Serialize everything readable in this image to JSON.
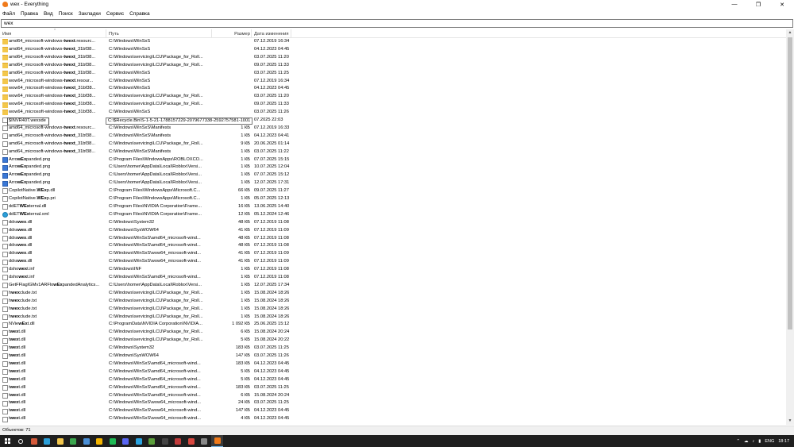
{
  "window": {
    "title": "wex - Everything",
    "controls": [
      "minimize",
      "maximize",
      "close"
    ]
  },
  "menu": [
    "Файл",
    "Правка",
    "Вид",
    "Поиск",
    "Закладки",
    "Сервис",
    "Справка"
  ],
  "search": {
    "value": "wex"
  },
  "columns": {
    "name": "Имя",
    "path": "Путь",
    "size": "Размер",
    "date": "Дата изменения"
  },
  "rename_box": {
    "value": "$INVR40T.wexsde"
  },
  "tooltip": {
    "text": "C:\\$Recycle.Bin\\S-1-5-21-1788157229-2079677338-2592757581-1001"
  },
  "rows": [
    {
      "name_pre": "amd64_microsoft-windows-",
      "name_match": "twext",
      "name_post": ".resourc...",
      "path": "C:\\Windows\\WinSxS",
      "size": "",
      "date": "07.12.2019 16:34",
      "icon": "folder"
    },
    {
      "name_pre": "amd64_microsoft-windows-",
      "name_match": "twext",
      "name_post": "_31bf38...",
      "path": "C:\\Windows\\WinSxS",
      "size": "",
      "date": "04.12.2023 04:45",
      "icon": "folder"
    },
    {
      "name_pre": "amd64_microsoft-windows-",
      "name_match": "twext",
      "name_post": "_31bf38...",
      "path": "C:\\Windows\\servicing\\LCU\\Package_for_Roll...",
      "size": "",
      "date": "03.07.2025 11:20",
      "icon": "folder"
    },
    {
      "name_pre": "amd64_microsoft-windows-",
      "name_match": "twext",
      "name_post": "_31bf38...",
      "path": "C:\\Windows\\servicing\\LCU\\Package_for_Roll...",
      "size": "",
      "date": "09.07.2025 11:33",
      "icon": "folder"
    },
    {
      "name_pre": "amd64_microsoft-windows-",
      "name_match": "twext",
      "name_post": "_31bf38...",
      "path": "C:\\Windows\\WinSxS",
      "size": "",
      "date": "03.07.2025 11:25",
      "icon": "folder"
    },
    {
      "name_pre": "wow64_microsoft-windows-",
      "name_match": "twext",
      "name_post": ".resour...",
      "path": "C:\\Windows\\WinSxS",
      "size": "",
      "date": "07.12.2019 16:34",
      "icon": "folder"
    },
    {
      "name_pre": "wow64_microsoft-windows-",
      "name_match": "twext",
      "name_post": "_31bf38...",
      "path": "C:\\Windows\\WinSxS",
      "size": "",
      "date": "04.12.2023 04:45",
      "icon": "folder"
    },
    {
      "name_pre": "wow64_microsoft-windows-",
      "name_match": "twext",
      "name_post": "_31bf38...",
      "path": "C:\\Windows\\servicing\\LCU\\Package_for_Roll...",
      "size": "",
      "date": "03.07.2025 11:20",
      "icon": "folder"
    },
    {
      "name_pre": "wow64_microsoft-windows-",
      "name_match": "twext",
      "name_post": "_31bf38...",
      "path": "C:\\Windows\\servicing\\LCU\\Package_for_Roll...",
      "size": "",
      "date": "09.07.2025 11:33",
      "icon": "folder"
    },
    {
      "name_pre": "wow64_microsoft-windows-",
      "name_match": "twext",
      "name_post": "_31bf38...",
      "path": "C:\\Windows\\WinSxS",
      "size": "",
      "date": "03.07.2025 11:26",
      "icon": "folder"
    },
    {
      "name_pre": "",
      "name_match": "",
      "name_post": "",
      "path": "",
      "size": "",
      "date": "07.2025 22:03",
      "icon": "file"
    },
    {
      "name_pre": "amd64_microsoft-windows-",
      "name_match": "twext",
      "name_post": ".resourc...",
      "path": "C:\\Windows\\WinSxS\\Manifests",
      "size": "1 КБ",
      "date": "07.12.2019 16:33",
      "icon": "file"
    },
    {
      "name_pre": "amd64_microsoft-windows-",
      "name_match": "twext",
      "name_post": "_31bf38...",
      "path": "C:\\Windows\\WinSxS\\Manifests",
      "size": "1 КБ",
      "date": "04.12.2023 04:41",
      "icon": "file"
    },
    {
      "name_pre": "amd64_microsoft-windows-",
      "name_match": "twext",
      "name_post": "_31bf38...",
      "path": "C:\\Windows\\servicing\\LCU\\Package_for_Roll...",
      "size": "9 КБ",
      "date": "20.06.2025 01:14",
      "icon": "file"
    },
    {
      "name_pre": "amd64_microsoft-windows-",
      "name_match": "twext",
      "name_post": "_31bf38...",
      "path": "C:\\Windows\\WinSxS\\Manifests",
      "size": "1 КБ",
      "date": "03.07.2025 11:22",
      "icon": "file"
    },
    {
      "name_pre": "Arro",
      "name_match": "wEx",
      "name_post": "panded.png",
      "path": "C:\\Program Files\\WindowsApps\\ROBLOXCO...",
      "size": "1 КБ",
      "date": "07.07.2025 15:15",
      "icon": "png"
    },
    {
      "name_pre": "Arro",
      "name_match": "wEx",
      "name_post": "panded.png",
      "path": "C:\\Users\\homer\\AppData\\Local\\Roblox\\Versi...",
      "size": "1 КБ",
      "date": "10.07.2025 12:04",
      "icon": "png"
    },
    {
      "name_pre": "Arro",
      "name_match": "wEx",
      "name_post": "panded.png",
      "path": "C:\\Users\\homer\\AppData\\Local\\Roblox\\Versi...",
      "size": "1 КБ",
      "date": "07.07.2025 15:12",
      "icon": "png"
    },
    {
      "name_pre": "Arro",
      "name_match": "wEx",
      "name_post": "panded.png",
      "path": "C:\\Users\\homer\\AppData\\Local\\Roblox\\Versi...",
      "size": "1 КБ",
      "date": "12.07.2025 17:31",
      "icon": "png"
    },
    {
      "name_pre": "CopilotNative.",
      "name_match": "WEx",
      "name_post": "p.dll",
      "path": "C:\\Program Files\\WindowsApps\\Microsoft.C...",
      "size": "66 КБ",
      "date": "09.07.2025 11:27",
      "icon": "file"
    },
    {
      "name_pre": "CopilotNative.",
      "name_match": "WEx",
      "name_post": "p.pri",
      "path": "C:\\Program Files\\WindowsApps\\Microsoft.C...",
      "size": "1 КБ",
      "date": "05.07.2025 12:13",
      "icon": "file"
    },
    {
      "name_pre": "ddET",
      "name_match": "WEx",
      "name_post": "ternal.dll",
      "path": "C:\\Program Files\\NVIDIA Corporation\\Frame...",
      "size": "16 КБ",
      "date": "13.06.2025 14:40",
      "icon": "file"
    },
    {
      "name_pre": "ddET",
      "name_match": "WEx",
      "name_post": "ternal.xml",
      "path": "C:\\Program Files\\NVIDIA Corporation\\Frame...",
      "size": "12 КБ",
      "date": "05.12.2024 12:46",
      "icon": "edge"
    },
    {
      "name_pre": "ddra",
      "name_match": "wex",
      "name_post": ".dll",
      "path": "C:\\Windows\\System32",
      "size": "48 КБ",
      "date": "07.12.2019 11:08",
      "icon": "file"
    },
    {
      "name_pre": "ddra",
      "name_match": "wex",
      "name_post": ".dll",
      "path": "C:\\Windows\\SysWOW64",
      "size": "41 КБ",
      "date": "07.12.2019 11:09",
      "icon": "file"
    },
    {
      "name_pre": "ddra",
      "name_match": "wex",
      "name_post": ".dll",
      "path": "C:\\Windows\\WinSxS\\amd64_microsoft-wind...",
      "size": "48 КБ",
      "date": "07.12.2019 11:08",
      "icon": "file"
    },
    {
      "name_pre": "ddra",
      "name_match": "wex",
      "name_post": ".dll",
      "path": "C:\\Windows\\WinSxS\\amd64_microsoft-wind...",
      "size": "48 КБ",
      "date": "07.12.2019 11:08",
      "icon": "file"
    },
    {
      "name_pre": "ddra",
      "name_match": "wex",
      "name_post": ".dll",
      "path": "C:\\Windows\\WinSxS\\wow64_microsoft-wind...",
      "size": "41 КБ",
      "date": "07.12.2019 11:09",
      "icon": "file"
    },
    {
      "name_pre": "ddra",
      "name_match": "wex",
      "name_post": ".dll",
      "path": "C:\\Windows\\WinSxS\\wow64_microsoft-wind...",
      "size": "41 КБ",
      "date": "07.12.2019 11:09",
      "icon": "file"
    },
    {
      "name_pre": "dsho",
      "name_match": "wex",
      "name_post": "t.inf",
      "path": "C:\\Windows\\INF",
      "size": "1 КБ",
      "date": "07.12.2019 11:08",
      "icon": "file"
    },
    {
      "name_pre": "dsho",
      "name_match": "wex",
      "name_post": "t.inf",
      "path": "C:\\Windows\\WinSxS\\amd64_microsoft-wind...",
      "size": "1 КБ",
      "date": "07.12.2019 11:08",
      "icon": "file"
    },
    {
      "name_pre": "GetFFlagIGMv1ARFlo",
      "name_match": "wEx",
      "name_post": "pandedAnalytics...",
      "path": "C:\\Users\\homer\\AppData\\Local\\Roblox\\Versi...",
      "size": "1 КБ",
      "date": "12.07.2025 17:34",
      "icon": "file"
    },
    {
      "name_pre": "h",
      "name_match": "wex",
      "name_post": "clude.txt",
      "path": "C:\\Windows\\servicing\\LCU\\Package_for_Roll...",
      "size": "1 КБ",
      "date": "15.08.2024 18:26",
      "icon": "text"
    },
    {
      "name_pre": "h",
      "name_match": "wex",
      "name_post": "clude.txt",
      "path": "C:\\Windows\\servicing\\LCU\\Package_for_Roll...",
      "size": "1 КБ",
      "date": "15.08.2024 18:26",
      "icon": "text"
    },
    {
      "name_pre": "h",
      "name_match": "wex",
      "name_post": "clude.txt",
      "path": "C:\\Windows\\servicing\\LCU\\Package_for_Roll...",
      "size": "1 КБ",
      "date": "15.08.2024 18:26",
      "icon": "text"
    },
    {
      "name_pre": "h",
      "name_match": "wex",
      "name_post": "clude.txt",
      "path": "C:\\Windows\\servicing\\LCU\\Package_for_Roll...",
      "size": "1 КБ",
      "date": "15.08.2024 18:26",
      "icon": "text"
    },
    {
      "name_pre": "NVie",
      "name_match": "wEx",
      "name_post": "t.dll",
      "path": "C:\\ProgramData\\NVIDIA Corporation\\NVIDIA...",
      "size": "1 092 КБ",
      "date": "25.06.2025 15:12",
      "icon": "file"
    },
    {
      "name_pre": "t",
      "name_match": "wex",
      "name_post": "t.dll",
      "path": "C:\\Windows\\servicing\\LCU\\Package_for_Roll...",
      "size": "6 КБ",
      "date": "15.08.2024 20:24",
      "icon": "file"
    },
    {
      "name_pre": "t",
      "name_match": "wex",
      "name_post": "t.dll",
      "path": "C:\\Windows\\servicing\\LCU\\Package_for_Roll...",
      "size": "5 КБ",
      "date": "15.08.2024 20:22",
      "icon": "file"
    },
    {
      "name_pre": "t",
      "name_match": "wex",
      "name_post": "t.dll",
      "path": "C:\\Windows\\System32",
      "size": "183 КБ",
      "date": "03.07.2025 11:25",
      "icon": "file"
    },
    {
      "name_pre": "t",
      "name_match": "wex",
      "name_post": "t.dll",
      "path": "C:\\Windows\\SysWOW64",
      "size": "147 КБ",
      "date": "03.07.2025 11:26",
      "icon": "file"
    },
    {
      "name_pre": "t",
      "name_match": "wex",
      "name_post": "t.dll",
      "path": "C:\\Windows\\WinSxS\\amd64_microsoft-wind...",
      "size": "183 КБ",
      "date": "04.12.2023 04:45",
      "icon": "file"
    },
    {
      "name_pre": "t",
      "name_match": "wex",
      "name_post": "t.dll",
      "path": "C:\\Windows\\WinSxS\\amd64_microsoft-wind...",
      "size": "5 КБ",
      "date": "04.12.2023 04:45",
      "icon": "file"
    },
    {
      "name_pre": "t",
      "name_match": "wex",
      "name_post": "t.dll",
      "path": "C:\\Windows\\WinSxS\\amd64_microsoft-wind...",
      "size": "5 КБ",
      "date": "04.12.2023 04:45",
      "icon": "file"
    },
    {
      "name_pre": "t",
      "name_match": "wex",
      "name_post": "t.dll",
      "path": "C:\\Windows\\WinSxS\\amd64_microsoft-wind...",
      "size": "183 КБ",
      "date": "03.07.2025 11:25",
      "icon": "file"
    },
    {
      "name_pre": "t",
      "name_match": "wex",
      "name_post": "t.dll",
      "path": "C:\\Windows\\WinSxS\\amd64_microsoft-wind...",
      "size": "6 КБ",
      "date": "15.08.2024 20:24",
      "icon": "file"
    },
    {
      "name_pre": "t",
      "name_match": "wex",
      "name_post": "t.dll",
      "path": "C:\\Windows\\WinSxS\\wow64_microsoft-wind...",
      "size": "24 КБ",
      "date": "03.07.2025 11:25",
      "icon": "file"
    },
    {
      "name_pre": "t",
      "name_match": "wex",
      "name_post": "t.dll",
      "path": "C:\\Windows\\WinSxS\\wow64_microsoft-wind...",
      "size": "147 КБ",
      "date": "04.12.2023 04:45",
      "icon": "file"
    },
    {
      "name_pre": "t",
      "name_match": "wex",
      "name_post": "t.dll",
      "path": "C:\\Windows\\WinSxS\\wow64_microsoft-wind...",
      "size": "4 КБ",
      "date": "04.12.2023 04:45",
      "icon": "file"
    }
  ],
  "status": {
    "text": "Объектов: 71"
  },
  "taskbar": {
    "apps": [
      {
        "icon": "search-icon",
        "color": "#1f1f1f"
      },
      {
        "icon": "copilot-icon",
        "color": "#d55a3a"
      },
      {
        "icon": "edge-icon",
        "color": "#2b9fd9"
      },
      {
        "icon": "explorer-icon",
        "color": "#f3c74c"
      },
      {
        "icon": "app-icon",
        "color": "#3aa64e"
      },
      {
        "icon": "store-icon",
        "color": "#4a8fd6"
      },
      {
        "icon": "chrome-icon",
        "color": "#f4b400"
      },
      {
        "icon": "spotify-icon",
        "color": "#1db954"
      },
      {
        "icon": "discord-icon",
        "color": "#5865f2"
      },
      {
        "icon": "telegram-icon",
        "color": "#2aa3e0"
      },
      {
        "icon": "minecraft-icon",
        "color": "#5a9e3a"
      },
      {
        "icon": "terminal-icon",
        "color": "#444444"
      },
      {
        "icon": "vpn-icon",
        "color": "#c23b3b"
      },
      {
        "icon": "media-icon",
        "color": "#d9473f"
      },
      {
        "icon": "photo-icon",
        "color": "#888888"
      },
      {
        "icon": "everything-icon",
        "color": "#f07a1a"
      }
    ],
    "tray": {
      "lang": "ENG",
      "time": "18:17"
    }
  }
}
